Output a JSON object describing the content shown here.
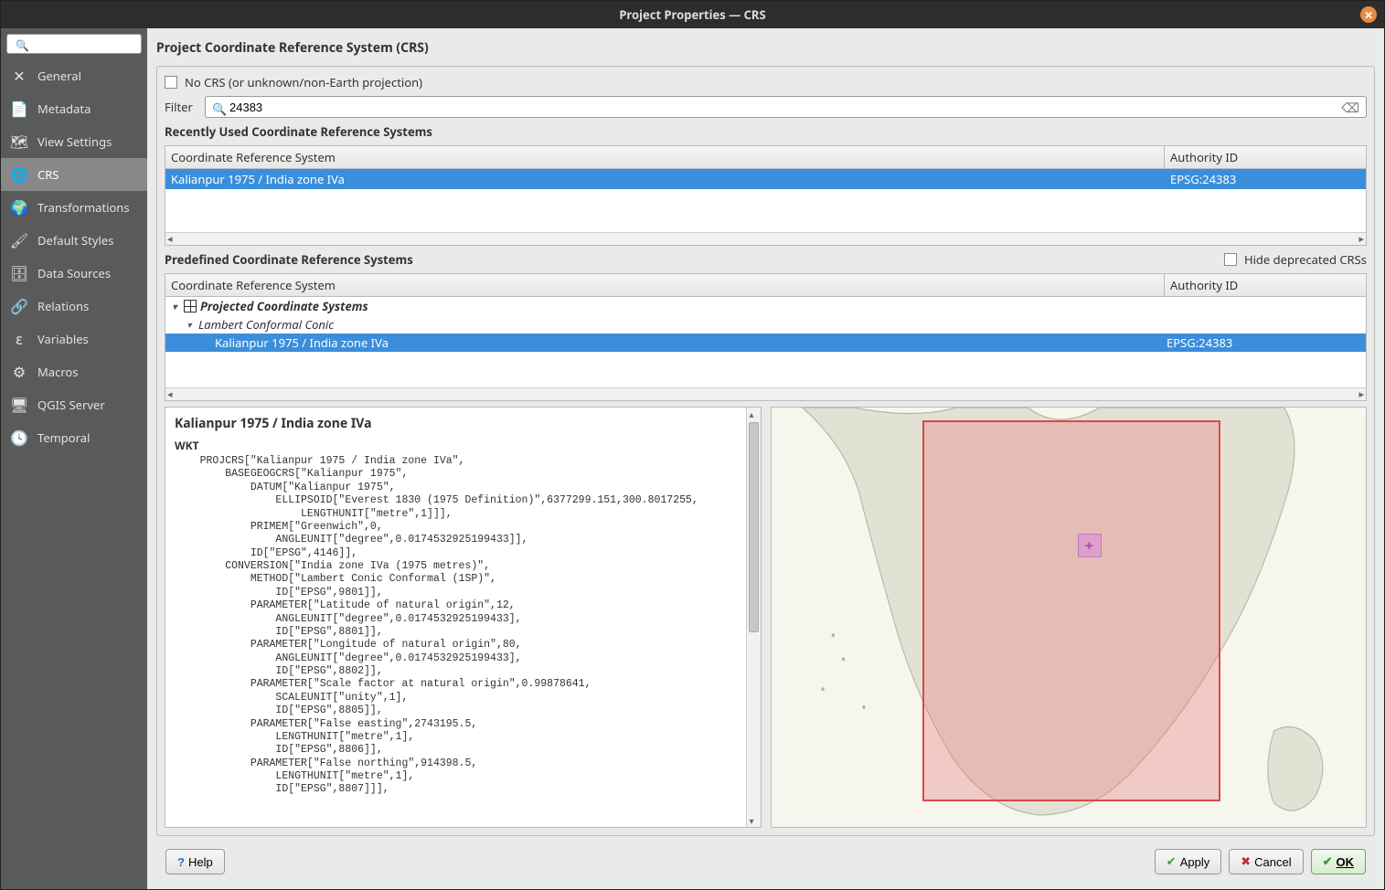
{
  "window": {
    "title": "Project Properties — CRS"
  },
  "sidebar": {
    "search_placeholder": "",
    "items": [
      {
        "label": "General",
        "icon": "settings-icon"
      },
      {
        "label": "Metadata",
        "icon": "metadata-icon"
      },
      {
        "label": "View Settings",
        "icon": "view-icon"
      },
      {
        "label": "CRS",
        "icon": "globe-icon"
      },
      {
        "label": "Transformations",
        "icon": "transform-icon"
      },
      {
        "label": "Default Styles",
        "icon": "styles-icon"
      },
      {
        "label": "Data Sources",
        "icon": "db-icon"
      },
      {
        "label": "Relations",
        "icon": "relations-icon"
      },
      {
        "label": "Variables",
        "icon": "variables-icon"
      },
      {
        "label": "Macros",
        "icon": "macros-icon"
      },
      {
        "label": "QGIS Server",
        "icon": "server-icon"
      },
      {
        "label": "Temporal",
        "icon": "clock-icon"
      }
    ],
    "active_index": 3
  },
  "main": {
    "section_title": "Project Coordinate Reference System (CRS)",
    "no_crs_label": "No CRS (or unknown/non-Earth projection)",
    "no_crs_checked": false,
    "filter_label": "Filter",
    "filter_value": "24383",
    "recent_title": "Recently Used Coordinate Reference Systems",
    "col_crs": "Coordinate Reference System",
    "col_auth": "Authority ID",
    "recent": [
      {
        "name": "Kalianpur 1975 / India zone IVa",
        "auth": "EPSG:24383",
        "selected": true
      }
    ],
    "predef_title": "Predefined Coordinate Reference Systems",
    "hide_deprecated_label": "Hide deprecated CRSs",
    "hide_deprecated_checked": false,
    "tree": {
      "root_label": "Projected Coordinate Systems",
      "group_label": "Lambert Conformal Conic",
      "leaf_name": "Kalianpur 1975 / India zone IVa",
      "leaf_auth": "EPSG:24383"
    },
    "details": {
      "name": "Kalianpur 1975 / India zone IVa",
      "wkt_heading": "WKT",
      "wkt": "    PROJCRS[\"Kalianpur 1975 / India zone IVa\",\n        BASEGEOGCRS[\"Kalianpur 1975\",\n            DATUM[\"Kalianpur 1975\",\n                ELLIPSOID[\"Everest 1830 (1975 Definition)\",6377299.151,300.8017255,\n                    LENGTHUNIT[\"metre\",1]]],\n            PRIMEM[\"Greenwich\",0,\n                ANGLEUNIT[\"degree\",0.0174532925199433]],\n            ID[\"EPSG\",4146]],\n        CONVERSION[\"India zone IVa (1975 metres)\",\n            METHOD[\"Lambert Conic Conformal (1SP)\",\n                ID[\"EPSG\",9801]],\n            PARAMETER[\"Latitude of natural origin\",12,\n                ANGLEUNIT[\"degree\",0.0174532925199433],\n                ID[\"EPSG\",8801]],\n            PARAMETER[\"Longitude of natural origin\",80,\n                ANGLEUNIT[\"degree\",0.0174532925199433],\n                ID[\"EPSG\",8802]],\n            PARAMETER[\"Scale factor at natural origin\",0.99878641,\n                SCALEUNIT[\"unity\",1],\n                ID[\"EPSG\",8805]],\n            PARAMETER[\"False easting\",2743195.5,\n                LENGTHUNIT[\"metre\",1],\n                ID[\"EPSG\",8806]],\n            PARAMETER[\"False northing\",914398.5,\n                LENGTHUNIT[\"metre\",1],\n                ID[\"EPSG\",8807]]],"
    }
  },
  "footer": {
    "help": "Help",
    "apply": "Apply",
    "cancel": "Cancel",
    "ok": "OK"
  },
  "icons": {
    "settings-icon": "✕",
    "metadata-icon": "📄",
    "view-icon": "🗺",
    "globe-icon": "🌐",
    "transform-icon": "🌍",
    "styles-icon": "🖌",
    "db-icon": "🗄",
    "relations-icon": "🔗",
    "variables-icon": "ε",
    "macros-icon": "⚙",
    "server-icon": "🖥",
    "clock-icon": "🕓"
  }
}
